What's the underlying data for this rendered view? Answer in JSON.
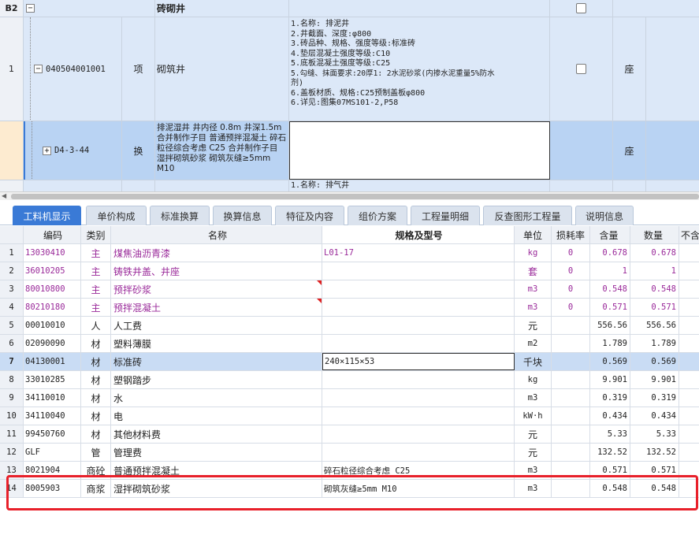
{
  "upper": {
    "group_row": {
      "rownum": "B2",
      "name": "砖砌井"
    },
    "rows": [
      {
        "rownum": "1",
        "code": "040504001001",
        "type": "项",
        "name": "砌筑井",
        "features": [
          "1.名称: 排泥井",
          "2.井截面、深度:φ800",
          "3.砖品种、规格、强度等级:标准砖",
          "4.垫层混凝土强度等级:C10",
          "5.底板混凝土强度等级:C25",
          "5.勾缝、抹面要求:20厚1: 2水泥砂浆(内掺水泥重量5%防水",
          "剂)",
          "6.盖板材质、规格:C25预制盖板φ800",
          "6.详见:图集07MS101-2,P58"
        ],
        "unit": "座"
      },
      {
        "rownum": "",
        "code": "D4-3-44",
        "type": "换",
        "name": "排泥湿井 井内径 0.8m 井深1.5m 合并制作子目 普通预拌混凝土 碎石粒径综合考虑 C25 合并制作子目 湿拌砌筑砂浆 砌筑灰缝≥5mm M10",
        "unit": "座"
      }
    ],
    "partial_row_text": "1.名称: 排气井"
  },
  "tabs": [
    {
      "label": "工料机显示",
      "active": true
    },
    {
      "label": "单价构成",
      "active": false
    },
    {
      "label": "标准换算",
      "active": false
    },
    {
      "label": "换算信息",
      "active": false
    },
    {
      "label": "特征及内容",
      "active": false
    },
    {
      "label": "组价方案",
      "active": false
    },
    {
      "label": "工程量明细",
      "active": false
    },
    {
      "label": "反查图形工程量",
      "active": false
    },
    {
      "label": "说明信息",
      "active": false
    }
  ],
  "lower": {
    "headers": {
      "code": "编码",
      "category": "类别",
      "name": "名称",
      "spec": "规格及型号",
      "unit": "单位",
      "loss": "损耗率",
      "content": "含量",
      "quantity": "数量",
      "tax": "不含"
    },
    "rows": [
      {
        "no": "1",
        "code": "13030410",
        "category": "主",
        "name": "煤焦油沥青漆",
        "spec": "L01-17",
        "unit": "kg",
        "loss": "0",
        "content": "0.678",
        "quantity": "0.678",
        "purple": true
      },
      {
        "no": "2",
        "code": "36010205",
        "category": "主",
        "name": "铸铁井盖、井座",
        "spec": "",
        "unit": "套",
        "loss": "0",
        "content": "1",
        "quantity": "1",
        "purple": true
      },
      {
        "no": "3",
        "code": "80010800",
        "category": "主",
        "name": "预拌砂浆",
        "spec": "",
        "unit": "m3",
        "loss": "0",
        "content": "0.548",
        "quantity": "0.548",
        "purple": true,
        "redmark": true
      },
      {
        "no": "4",
        "code": "80210180",
        "category": "主",
        "name": "预拌混凝土",
        "spec": "",
        "unit": "m3",
        "loss": "0",
        "content": "0.571",
        "quantity": "0.571",
        "purple": true,
        "redmark": true
      },
      {
        "no": "5",
        "code": "00010010",
        "category": "人",
        "name": "人工费",
        "spec": "",
        "unit": "元",
        "loss": "",
        "content": "556.56",
        "quantity": "556.56"
      },
      {
        "no": "6",
        "code": "02090090",
        "category": "材",
        "name": "塑料薄膜",
        "spec": "",
        "unit": "m2",
        "loss": "",
        "content": "1.789",
        "quantity": "1.789"
      },
      {
        "no": "7",
        "code": "04130001",
        "category": "材",
        "name": "标准砖",
        "spec": "240×115×53",
        "unit": "千块",
        "loss": "",
        "content": "0.569",
        "quantity": "0.569",
        "selected": true
      },
      {
        "no": "8",
        "code": "33010285",
        "category": "材",
        "name": "塑钢踏步",
        "spec": "",
        "unit": "kg",
        "loss": "",
        "content": "9.901",
        "quantity": "9.901"
      },
      {
        "no": "9",
        "code": "34110010",
        "category": "材",
        "name": "水",
        "spec": "",
        "unit": "m3",
        "loss": "",
        "content": "0.319",
        "quantity": "0.319"
      },
      {
        "no": "10",
        "code": "34110040",
        "category": "材",
        "name": "电",
        "spec": "",
        "unit": "kW·h",
        "loss": "",
        "content": "0.434",
        "quantity": "0.434"
      },
      {
        "no": "11",
        "code": "99450760",
        "category": "材",
        "name": "其他材料费",
        "spec": "",
        "unit": "元",
        "loss": "",
        "content": "5.33",
        "quantity": "5.33"
      },
      {
        "no": "12",
        "code": "GLF",
        "category": "管",
        "name": "管理费",
        "spec": "",
        "unit": "元",
        "loss": "",
        "content": "132.52",
        "quantity": "132.52"
      },
      {
        "no": "13",
        "code": "8021904",
        "category": "商砼",
        "name": "普通预拌混凝土",
        "spec": "碎石粒径综合考虑 C25",
        "unit": "m3",
        "loss": "",
        "content": "0.571",
        "quantity": "0.571"
      },
      {
        "no": "14",
        "code": "8005903",
        "category": "商浆",
        "name": "湿拌砌筑砂浆",
        "spec": "砌筑灰缝≥5mm M10",
        "unit": "m3",
        "loss": "",
        "content": "0.548",
        "quantity": "0.548"
      }
    ]
  },
  "colors": {
    "accent": "#3a7ad6",
    "highlight_box": "#e8202a",
    "main_material_text": "#9a2a9a",
    "selected_row": "#c9dcf4",
    "upper_row_bg": "#dce8f8",
    "upper_subrow_bg": "#fdebd0"
  }
}
